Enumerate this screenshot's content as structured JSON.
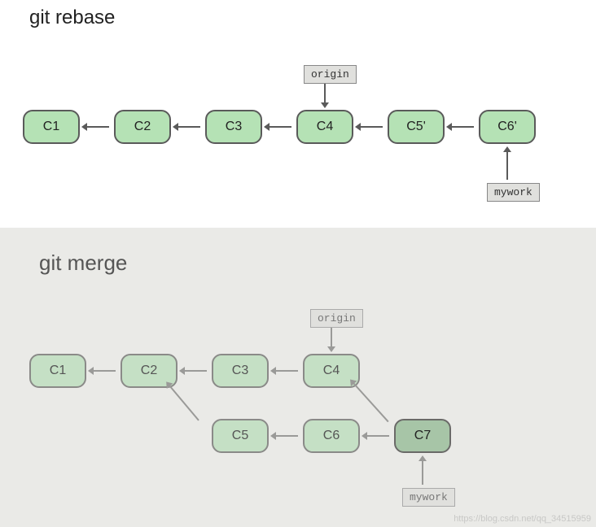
{
  "rebase": {
    "title": "git rebase",
    "commits": [
      "C1",
      "C2",
      "C3",
      "C4",
      "C5'",
      "C6'"
    ],
    "tags": {
      "origin": "origin",
      "mywork": "mywork"
    },
    "origin_points_to": "C4",
    "mywork_points_to": "C6'"
  },
  "merge": {
    "title": "git merge",
    "main_commits": [
      "C1",
      "C2",
      "C3",
      "C4"
    ],
    "branch_commits": [
      "C5",
      "C6"
    ],
    "merge_commit": "C7",
    "tags": {
      "origin": "origin",
      "mywork": "mywork"
    },
    "origin_points_to": "C4",
    "mywork_points_to": "C7",
    "merge_parents": [
      "C4",
      "C6"
    ],
    "branch_base": "C2"
  },
  "watermark": "https://blog.csdn.net/qq_34515959"
}
